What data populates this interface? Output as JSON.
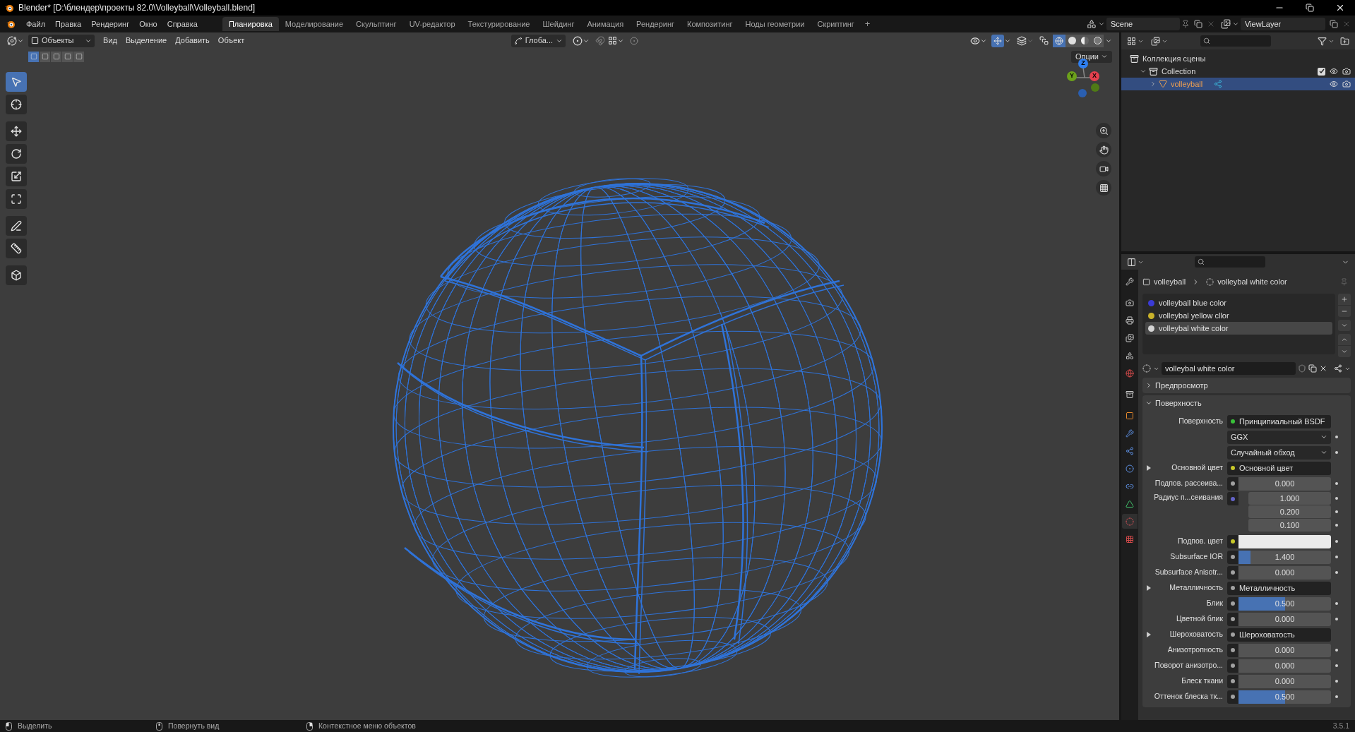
{
  "window": {
    "title": "Blender* [D:\\блендер\\проекты 82.0\\Volleyball\\Volleyball.blend]"
  },
  "menu": [
    "Файл",
    "Правка",
    "Рендеринг",
    "Окно",
    "Справка"
  ],
  "workspaces": [
    {
      "label": "Планировка",
      "selected": true
    },
    {
      "label": "Моделирование",
      "selected": false
    },
    {
      "label": "Скульптинг",
      "selected": false
    },
    {
      "label": "UV-редактор",
      "selected": false
    },
    {
      "label": "Текстурирование",
      "selected": false
    },
    {
      "label": "Шейдинг",
      "selected": false
    },
    {
      "label": "Анимация",
      "selected": false
    },
    {
      "label": "Рендеринг",
      "selected": false
    },
    {
      "label": "Композитинг",
      "selected": false
    },
    {
      "label": "Ноды геометрии",
      "selected": false
    },
    {
      "label": "Скриптинг",
      "selected": false
    }
  ],
  "workspace_add": "+",
  "scene": {
    "name": "Scene"
  },
  "view_layer": {
    "name": "ViewLayer"
  },
  "viewport": {
    "mode": "Объекты",
    "menus": [
      "Вид",
      "Выделение",
      "Добавить",
      "Объект"
    ],
    "orientation": "Глоба...",
    "options": "Опции",
    "select_modes": [
      {
        "selected": true
      },
      {
        "selected": false
      },
      {
        "selected": false
      },
      {
        "selected": false
      },
      {
        "selected": false
      }
    ],
    "gizmo_toggle": {
      "selected": true
    },
    "shading": [
      {
        "kind": "wireframe",
        "selected": true
      },
      {
        "kind": "solid",
        "selected": false
      },
      {
        "kind": "material",
        "selected": false
      },
      {
        "kind": "rendered",
        "selected": false
      }
    ],
    "axes": [
      {
        "label": "Z",
        "kind": "z"
      },
      {
        "label": "Y",
        "kind": "y"
      },
      {
        "label": "X",
        "kind": "x"
      }
    ],
    "tools": [
      {
        "kind": "select",
        "selected": true
      },
      {
        "kind": "cursor",
        "selected": false
      },
      {
        "kind": "move",
        "selected": false
      },
      {
        "kind": "rotate",
        "selected": false
      },
      {
        "kind": "scale",
        "selected": false
      },
      {
        "kind": "transform",
        "selected": false
      },
      {
        "kind": "annotate",
        "selected": false
      },
      {
        "kind": "measure",
        "selected": false
      },
      {
        "kind": "add-cube",
        "selected": false
      }
    ]
  },
  "outliner": {
    "items": [
      {
        "label": "Коллекция сцены",
        "kind": "scene",
        "children": [
          {
            "label": "Collection",
            "kind": "collection",
            "expanded": true,
            "checked": true,
            "children": [
              {
                "label": "volleyball",
                "kind": "object",
                "expanded": false,
                "selected": true
              }
            ]
          }
        ]
      }
    ]
  },
  "properties": {
    "tabs": [
      {
        "kind": "tool",
        "selected": false
      },
      {
        "kind": "render",
        "selected": false
      },
      {
        "kind": "output",
        "selected": false
      },
      {
        "kind": "view-layer",
        "selected": false
      },
      {
        "kind": "scene",
        "selected": false
      },
      {
        "kind": "world",
        "selected": false
      },
      {
        "kind": "collection",
        "selected": false
      },
      {
        "kind": "object",
        "selected": false
      },
      {
        "kind": "modifiers",
        "selected": false
      },
      {
        "kind": "particles",
        "selected": false
      },
      {
        "kind": "physics",
        "selected": false
      },
      {
        "kind": "constraints",
        "selected": false
      },
      {
        "kind": "data",
        "selected": false
      },
      {
        "kind": "material",
        "selected": true
      },
      {
        "kind": "texture",
        "selected": false
      }
    ],
    "breadcrumb": [
      "volleyball",
      "volleybal white color"
    ],
    "slots": [
      {
        "label": "volleyball blue color",
        "color": "#3b3bd6",
        "selected": false
      },
      {
        "label": "volleybal yellow cllor",
        "color": "#c9b22a",
        "selected": false
      },
      {
        "label": "volleybal white color",
        "color": "#d4d4d4",
        "selected": true
      }
    ],
    "material_name": "volleybal white color",
    "panels": [
      {
        "label": "Предпросмотр",
        "expanded": false
      },
      {
        "label": "Поверхность",
        "expanded": true
      }
    ],
    "rows": [
      {
        "kind": "link",
        "label": "Поверхность",
        "value": "Принципиальный BSDF",
        "color": "#39c139"
      },
      {
        "kind": "dropdown",
        "value": "GGX"
      },
      {
        "kind": "dropdown",
        "value": "Случайный обход"
      },
      {
        "kind": "link",
        "label": "Основной цвет",
        "value": "Основной цвет",
        "color": "#c7c729",
        "expandable": true
      },
      {
        "kind": "number",
        "label": "Подпов. рассеива...",
        "value": "0.000",
        "level": 0,
        "color": "#a1a1a1"
      },
      {
        "kind": "vector",
        "label": "Радиус п...сеивания",
        "values": [
          "1.000",
          "0.200",
          "0.100"
        ],
        "color": "#6363c7"
      },
      {
        "kind": "color",
        "label": "Подпов. цвет",
        "swatch": {
          "color": "#ebebeb"
        },
        "color": "#c7c729"
      },
      {
        "kind": "number",
        "label": "Subsurface IOR",
        "value": "1.400",
        "level": 0.13,
        "color": "#a1a1a1"
      },
      {
        "kind": "number",
        "label": "Subsurface Anisotr...",
        "value": "0.000",
        "level": 0,
        "color": "#a1a1a1"
      },
      {
        "kind": "link",
        "label": "Металличность",
        "value": "Металличность",
        "color": "#a1a1a1",
        "expandable": true
      },
      {
        "kind": "number",
        "label": "Блик",
        "value": "0.500",
        "level": 0.5,
        "color": "#a1a1a1"
      },
      {
        "kind": "number",
        "label": "Цветной блик",
        "value": "0.000",
        "level": 0,
        "color": "#a1a1a1"
      },
      {
        "kind": "link",
        "label": "Шероховатость",
        "value": "Шероховатость",
        "color": "#a1a1a1",
        "expandable": true
      },
      {
        "kind": "number",
        "label": "Анизотропность",
        "value": "0.000",
        "level": 0,
        "color": "#a1a1a1"
      },
      {
        "kind": "number",
        "label": "Поворот анизотро...",
        "value": "0.000",
        "level": 0,
        "color": "#a1a1a1"
      },
      {
        "kind": "number",
        "label": "Блеск ткани",
        "value": "0.000",
        "level": 0,
        "color": "#a1a1a1"
      },
      {
        "kind": "number",
        "label": "Оттенок блеска тк...",
        "value": "0.500",
        "level": 0.5,
        "color": "#a1a1a1"
      }
    ]
  },
  "status_bar": {
    "items": [
      {
        "label": "Выделить",
        "kind": "left"
      },
      {
        "label": "Повернуть вид",
        "kind": "middle"
      },
      {
        "label": "Контекстное меню объектов",
        "kind": "right"
      }
    ],
    "version": "3.5.1"
  }
}
